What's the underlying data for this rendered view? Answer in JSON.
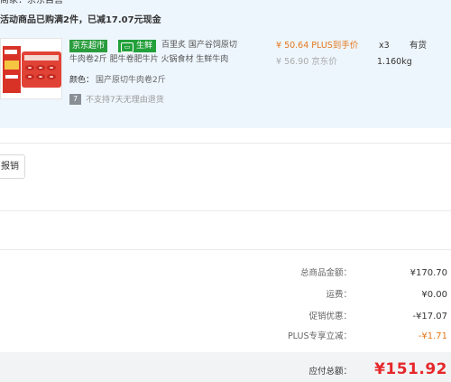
{
  "seller": "商家：京东自营",
  "promo": "活动商品已购满2件，已减17.07元现金",
  "product": {
    "badges": {
      "jd_market": "京东超市",
      "fresh": "生鲜"
    },
    "title_line1": "百里炙 国产谷饲原切",
    "title_line2": "牛肉卷2斤 肥牛卷肥牛片 火锅食材 生鲜牛肉",
    "spec_label": "颜色：",
    "spec_value": "国产原切牛肉卷2斤",
    "return_policy": "不支持7天无理由退货",
    "price_plus": "¥ 50.64 PLUS到手价",
    "price_jd": "¥ 56.90 京东价",
    "quantity": "x3",
    "weight": "1.160kg",
    "stock": "有货"
  },
  "report_button": "报销",
  "summary": [
    {
      "label": "总商品金额：",
      "value": "¥170.70",
      "color": "#333333"
    },
    {
      "label": "运费：",
      "value": "¥0.00",
      "color": "#333333"
    },
    {
      "label": "促销优惠：",
      "value": "-¥17.07",
      "color": "#333333"
    },
    {
      "label": "PLUS专享立减：",
      "value": "-¥1.71",
      "color": "#e4781c"
    }
  ],
  "payable": {
    "label": "应付总额：",
    "value": "¥151.92"
  },
  "colors": {
    "panel_bg": "#eef6fd",
    "accent_red": "#e5282b",
    "plus_orange": "#e4781c",
    "jd_green": "#2a9c3d"
  }
}
